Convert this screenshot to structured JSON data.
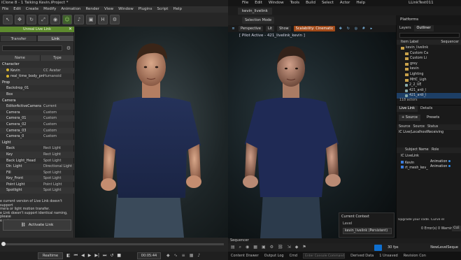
{
  "left_app": {
    "title": "iClone 8 - 1 Talking Kevin.iProject *",
    "menu": [
      "File",
      "Edit",
      "Create",
      "Modify",
      "Animation",
      "Render",
      "View",
      "Window",
      "Plugins",
      "Script",
      "Help"
    ],
    "panel": {
      "header": "Unreal Live Link",
      "tabs": [
        "Transfer",
        "Link"
      ],
      "columns": [
        "Name",
        "Type"
      ],
      "tree": [
        {
          "kind": "cat",
          "name": "Character",
          "type": ""
        },
        {
          "kind": "item",
          "name": "Kevin",
          "type": "CC Avatar",
          "checked": true
        },
        {
          "kind": "item",
          "name": "real_time_body_preview",
          "type": "Humanoid",
          "checked": true
        },
        {
          "kind": "cat",
          "name": "Prop",
          "type": ""
        },
        {
          "kind": "item",
          "name": "Backdrop_01",
          "type": ""
        },
        {
          "kind": "item",
          "name": "Box",
          "type": ""
        },
        {
          "kind": "cat",
          "name": "Camera",
          "type": ""
        },
        {
          "kind": "item",
          "name": "EditorActiveCamera",
          "type": "Current"
        },
        {
          "kind": "item",
          "name": "Camera",
          "type": "Custom"
        },
        {
          "kind": "item",
          "name": "Camera_01",
          "type": "Custom"
        },
        {
          "kind": "item",
          "name": "Camera_02",
          "type": "Custom"
        },
        {
          "kind": "item",
          "name": "Camera_03",
          "type": "Custom"
        },
        {
          "kind": "item",
          "name": "Camera_0",
          "type": "Custom"
        },
        {
          "kind": "cat",
          "name": "Light",
          "type": ""
        },
        {
          "kind": "item",
          "name": "Back",
          "type": "Rect Light"
        },
        {
          "kind": "item",
          "name": "Key",
          "type": "Rect Light"
        },
        {
          "kind": "item",
          "name": "Back Light_Head",
          "type": "Spot Light"
        },
        {
          "kind": "item",
          "name": "Dir. Light",
          "type": "Directional Light"
        },
        {
          "kind": "item",
          "name": "Fill",
          "type": "Spot Light"
        },
        {
          "kind": "item",
          "name": "Key_Front",
          "type": "Spot Light"
        },
        {
          "kind": "item",
          "name": "Point Light",
          "type": "Point Light"
        },
        {
          "kind": "item",
          "name": "Spotlight",
          "type": "Spot Light"
        }
      ],
      "note": "e current version of Live Link doesn't support\nmera or light motion transfer.\ne Link doesn't support identical naming, please\ne unique names.",
      "activate_label": "Activate Link"
    },
    "realtime_label": "Realtime",
    "timecode": "00:05:44"
  },
  "right_app": {
    "menu": [
      "File",
      "Edit",
      "Window",
      "Tools",
      "Build",
      "Select",
      "Actor",
      "Help"
    ],
    "project_name": "LLinkTest011",
    "level_tab": "kevin_livelink",
    "selection_mode": "Selection Mode",
    "platforms": "Platforms",
    "viewport_bar": [
      "Perspective",
      "Lit",
      "Show"
    ],
    "scalability_warning": "Scalability: Cinematic",
    "pilot_text": "[ Pilot Active - 421_livelink_kevin ]",
    "outliner": {
      "tabs": [
        "Layers",
        "Outliner"
      ],
      "header_label": "Item Label",
      "header_right": "Sequencer",
      "rows": [
        {
          "indent": 1,
          "kind": "folder",
          "label": "kevin_livelink"
        },
        {
          "indent": 2,
          "kind": "folder",
          "label": "Custom Ca"
        },
        {
          "indent": 2,
          "kind": "folder",
          "label": "Custom Li"
        },
        {
          "indent": 2,
          "kind": "folder",
          "label": "grey"
        },
        {
          "indent": 2,
          "kind": "folder",
          "label": "kevin"
        },
        {
          "indent": 2,
          "kind": "folder",
          "label": "Lighting"
        },
        {
          "indent": 2,
          "kind": "folder",
          "label": "MHC_Ligh"
        },
        {
          "indent": 2,
          "kind": "actor",
          "label": "2_2_UE"
        },
        {
          "indent": 2,
          "kind": "actor",
          "label": "421_ardi_l"
        },
        {
          "indent": 2,
          "kind": "actor",
          "label": "421_ardi_l",
          "selected": true
        }
      ],
      "actor_count": "118 actors"
    },
    "livelink": {
      "tabs": [
        "Live Link",
        "Details"
      ],
      "add_source": "+ Source",
      "presets": "Presets",
      "source_columns": [
        "Source",
        "Source",
        "Status"
      ],
      "source_row": "IC Live(LocalhostReceiving",
      "subject_columns": [
        "Subject Name",
        "Role"
      ],
      "subjects": [
        {
          "name": "IC LiveLink",
          "role": "",
          "group": true
        },
        {
          "name": "Kevin",
          "role": "Animation"
        },
        {
          "name": "rt_mesh_kev_",
          "role": "Animation"
        }
      ]
    },
    "current_context": {
      "title": "Current Context",
      "level_label": "Level",
      "value": "kevin_livelink (Persistent)"
    },
    "console_message": "Upgrade your code. Curve el",
    "error_count": "0 Error(s)  0 Warning(s)",
    "clear_label": "CLE",
    "sequencer_tab": "Sequencer",
    "fps": "30 fps",
    "sequence_name": "NewLevelSeque",
    "status_items": [
      "Content Drawer",
      "Output Log",
      "Cmd"
    ],
    "cmd_placeholder": "Enter Console Command",
    "status_right": [
      "Derived Data",
      "1 Unsaved",
      "Revision Con"
    ]
  }
}
